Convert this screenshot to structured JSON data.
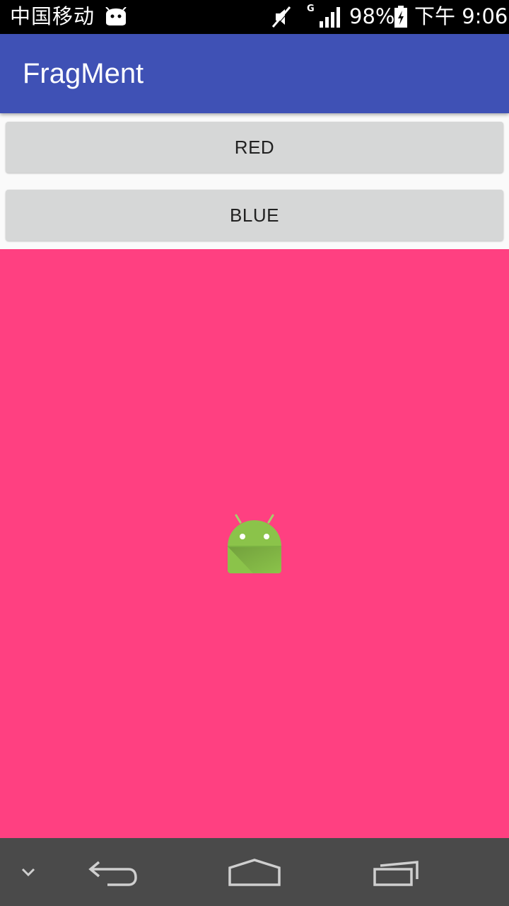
{
  "status_bar": {
    "carrier": "中国移动",
    "network_type": "G",
    "battery": "98%",
    "time": "下午 9:06",
    "icons": [
      "android-notification-icon",
      "mute-icon",
      "signal-icon",
      "battery-charging-icon"
    ]
  },
  "app_bar": {
    "title": "FragMent",
    "color": "#3f51b5"
  },
  "buttons": {
    "red_label": "RED",
    "blue_label": "BLUE"
  },
  "fragment": {
    "background_color": "#ff4081",
    "icon": "android-launcher-icon"
  },
  "nav_bar": {
    "icons": [
      "collapse-icon",
      "back-icon",
      "home-icon",
      "recent-apps-icon"
    ]
  }
}
